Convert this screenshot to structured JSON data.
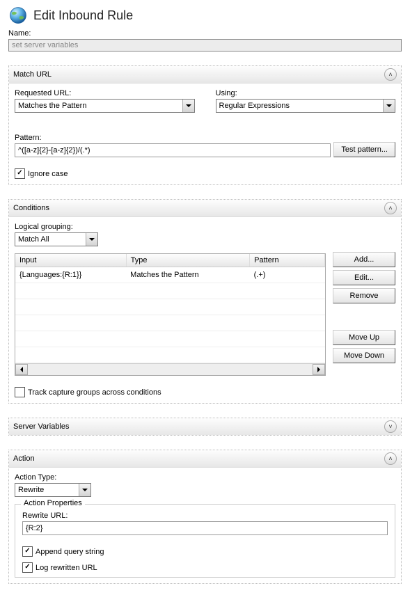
{
  "title": "Edit Inbound Rule",
  "name": {
    "label": "Name:",
    "value": "set server variables"
  },
  "match_url": {
    "title": "Match URL",
    "requested_label": "Requested URL:",
    "requested_value": "Matches the Pattern",
    "using_label": "Using:",
    "using_value": "Regular Expressions",
    "pattern_label": "Pattern:",
    "pattern_value": "^([a-z]{2}-[a-z]{2})/(.*)",
    "test_button": "Test pattern...",
    "ignore_case_label": "Ignore case"
  },
  "conditions": {
    "title": "Conditions",
    "grouping_label": "Logical grouping:",
    "grouping_value": "Match All",
    "columns": {
      "input": "Input",
      "type": "Type",
      "pattern": "Pattern"
    },
    "rows": [
      {
        "input": "{Languages:{R:1}}",
        "type": "Matches the Pattern",
        "pattern": "(.+)"
      }
    ],
    "buttons": {
      "add": "Add...",
      "edit": "Edit...",
      "remove": "Remove",
      "move_up": "Move Up",
      "move_down": "Move Down"
    },
    "track_label": "Track capture groups across conditions"
  },
  "server_vars": {
    "title": "Server Variables"
  },
  "action": {
    "title": "Action",
    "type_label": "Action Type:",
    "type_value": "Rewrite",
    "props_label": "Action Properties",
    "rewrite_label": "Rewrite URL:",
    "rewrite_value": "{R:2}",
    "append_label": "Append query string",
    "log_label": "Log rewritten URL"
  }
}
